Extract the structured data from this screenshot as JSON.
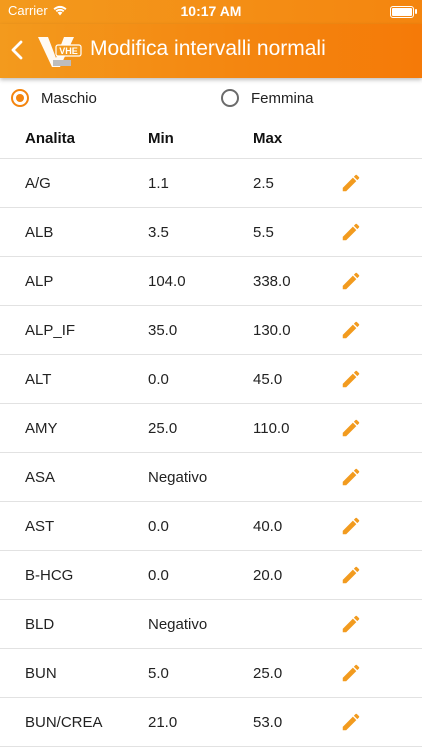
{
  "status_bar": {
    "carrier": "Carrier",
    "time": "10:17 AM"
  },
  "app_bar": {
    "title": "Modifica intervalli normali",
    "logo_text": "VHE"
  },
  "gender": {
    "male_label": "Maschio",
    "female_label": "Femmina",
    "selected": "male"
  },
  "table": {
    "headers": {
      "analyte": "Analita",
      "min": "Min",
      "max": "Max"
    },
    "rows": [
      {
        "analyte": "A/G",
        "min": "1.1",
        "max": "2.5"
      },
      {
        "analyte": "ALB",
        "min": "3.5",
        "max": "5.5"
      },
      {
        "analyte": "ALP",
        "min": "104.0",
        "max": "338.0"
      },
      {
        "analyte": "ALP_IF",
        "min": "35.0",
        "max": "130.0"
      },
      {
        "analyte": "ALT",
        "min": "0.0",
        "max": "45.0"
      },
      {
        "analyte": "AMY",
        "min": "25.0",
        "max": "110.0"
      },
      {
        "analyte": "ASA",
        "min": "Negativo",
        "max": ""
      },
      {
        "analyte": "AST",
        "min": "0.0",
        "max": "40.0"
      },
      {
        "analyte": "B-HCG",
        "min": "0.0",
        "max": "20.0"
      },
      {
        "analyte": "BLD",
        "min": "Negativo",
        "max": ""
      },
      {
        "analyte": "BUN",
        "min": "5.0",
        "max": "25.0"
      },
      {
        "analyte": "BUN/CREA",
        "min": "21.0",
        "max": "53.0"
      }
    ]
  },
  "colors": {
    "accent": "#f4850f",
    "edit_icon": "#f29b1f"
  },
  "icons": {
    "back": "chevron-left-icon",
    "edit": "pencil-icon",
    "wifi": "wifi-icon",
    "battery": "battery-icon"
  }
}
